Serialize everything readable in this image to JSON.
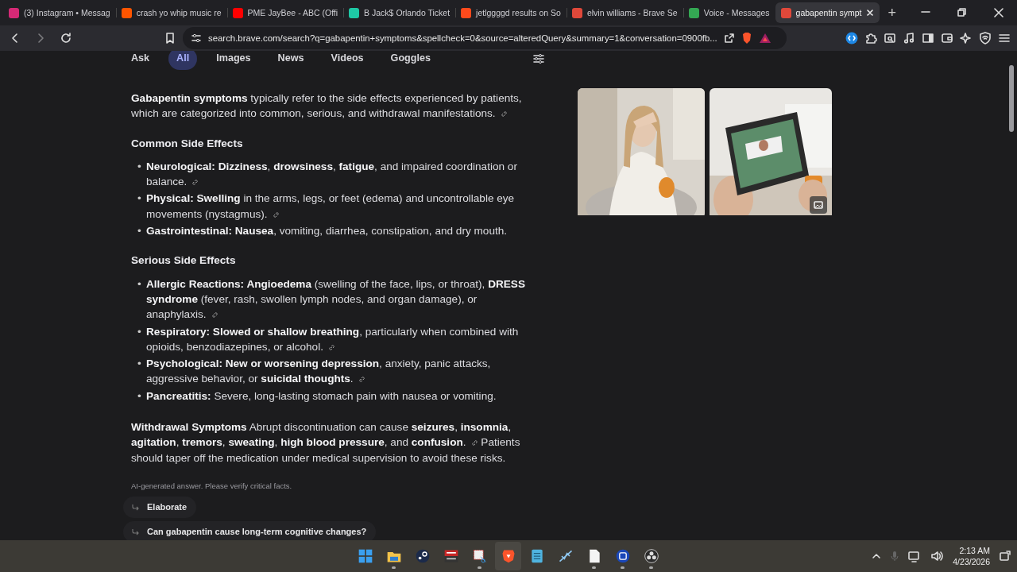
{
  "browser": {
    "tabs": [
      {
        "title": "(3) Instagram • Messag",
        "color": "#d62976",
        "selected": false
      },
      {
        "title": "crash yo whip music re",
        "color": "#ff5500",
        "selected": false
      },
      {
        "title": "PME JayBee - ABC (Offi",
        "color": "#ff0000",
        "selected": false
      },
      {
        "title": "B Jack$ Orlando Ticket",
        "color": "#1ec8a5",
        "selected": false
      },
      {
        "title": "jetlggggd results on So",
        "color": "#ff4a1c",
        "selected": false
      },
      {
        "title": "elvin williams - Brave Se",
        "color": "#e0483a",
        "selected": false
      },
      {
        "title": "Voice - Messages",
        "color": "#34a853",
        "selected": false
      },
      {
        "title": "gabapentin sympt",
        "color": "#e0483a",
        "selected": true
      }
    ],
    "new_tab": "+",
    "url": "search.brave.com/search?q=gabapentin+symptoms&spellcheck=0&source=alteredQuery&summary=1&conversation=0900fb..."
  },
  "search_nav": {
    "tabs": [
      {
        "label": "Ask",
        "selected": false
      },
      {
        "label": "All",
        "selected": true
      },
      {
        "label": "Images",
        "selected": false
      },
      {
        "label": "News",
        "selected": false
      },
      {
        "label": "Videos",
        "selected": false
      },
      {
        "label": "Goggles",
        "selected": false
      }
    ]
  },
  "answer": {
    "blocks": [
      {
        "kind": "paragraph",
        "text": "**Gabapentin symptoms** typically refer to the side effects experienced by patients, which are categorized into common, serious, and withdrawal manifestations.",
        "link_icon": true
      },
      {
        "kind": "heading",
        "text": "Common Side Effects"
      },
      {
        "kind": "list",
        "items": [
          {
            "bullet": "•",
            "text": "**Neurological: Dizziness**, **drowsiness**, **fatigue**, and impaired coordination or balance.",
            "link_icon": true
          },
          {
            "bullet": "•",
            "text": "**Physical: Swelling** in the arms, legs, or feet (edema) and uncontrollable eye movements (nystagmus).",
            "link_icon": true
          },
          {
            "bullet": "•",
            "text": "**Gastrointestinal: Nausea**, vomiting, diarrhea, constipation, and dry mouth.",
            "link_icon": false
          }
        ]
      },
      {
        "kind": "heading",
        "text": "Serious Side Effects"
      },
      {
        "kind": "list",
        "items": [
          {
            "bullet": "•",
            "text": "**Allergic Reactions: Angioedema** (swelling of the face, lips, or throat), **DRESS syndrome** (fever, rash, swollen lymph nodes, and organ damage), or anaphylaxis.",
            "link_icon": true
          },
          {
            "bullet": "•",
            "text": "**Respiratory: Slowed or shallow breathing**, particularly when combined with opioids, benzodiazepines, or alcohol.",
            "link_icon": true
          },
          {
            "bullet": "•",
            "text": "**Psychological: New or worsening depression**, anxiety, panic attacks, aggressive behavior, or **suicidal thoughts**.",
            "link_icon": true
          },
          {
            "bullet": "•",
            "text": "**Pancreatitis:** Severe, long-lasting stomach pain with nausea or vomiting.",
            "link_icon": false
          }
        ]
      },
      {
        "kind": "paragraph",
        "text": "**Withdrawal Symptoms** Abrupt discontinuation can cause **seizures**, **insomnia**, **agitation**, **tremors**, **sweating**, **high blood pressure**, and **confusion**.",
        "link_icon": true,
        "text_after": "Patients should taper off the medication under medical supervision to avoid these risks."
      }
    ],
    "disclaimer": "AI-generated answer. Please verify critical facts.",
    "followups": [
      "Elaborate",
      "Can gabapentin cause long-term cognitive changes?"
    ],
    "images": [
      {
        "kind": "picture"
      },
      {
        "kind": "picture"
      }
    ]
  },
  "taskbar": {
    "apps": [
      {
        "running": false,
        "active": false
      },
      {
        "running": true,
        "active": false
      },
      {
        "running": false,
        "active": false
      },
      {
        "running": false,
        "active": false
      },
      {
        "running": true,
        "active": false
      },
      {
        "running": false,
        "active": true
      },
      {
        "running": false,
        "active": false
      },
      {
        "running": false,
        "active": false
      },
      {
        "running": true,
        "active": false
      },
      {
        "running": true,
        "active": false
      },
      {
        "running": true,
        "active": false
      }
    ],
    "time": "2:13 AM",
    "date": "4/23/2026"
  }
}
